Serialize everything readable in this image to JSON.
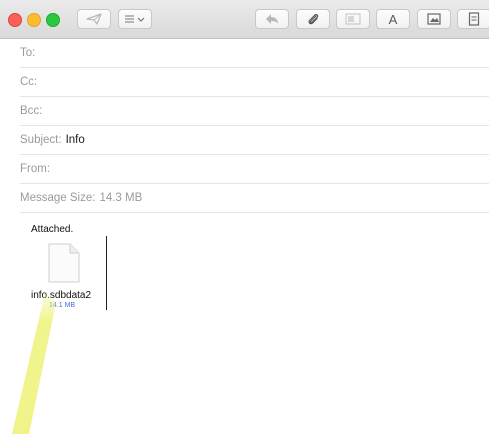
{
  "window": {
    "colors": {
      "close": "#fc5f57",
      "minimize": "#fdbc2e",
      "zoom": "#28c840"
    }
  },
  "toolbar": {
    "buttons": [
      {
        "name": "send-icon"
      },
      {
        "name": "list-format-icon"
      },
      {
        "name": "reply-icon"
      },
      {
        "name": "paperclip-icon"
      },
      {
        "name": "show-format-bar-icon"
      },
      {
        "name": "font-icon",
        "label": "A"
      },
      {
        "name": "photo-browser-icon"
      },
      {
        "name": "stationery-icon"
      }
    ]
  },
  "header": {
    "to_label": "To:",
    "cc_label": "Cc:",
    "bcc_label": "Bcc:",
    "subject_label": "Subject:",
    "subject_value": "Info",
    "from_label": "From:",
    "message_size_label": "Message Size:",
    "message_size_value": "14.3 MB"
  },
  "body": {
    "text": "Attached.",
    "attachment": {
      "filename": "info.sdbdata2",
      "size": "14.1 MB",
      "icon": "document-icon"
    }
  },
  "overlay": {
    "highlight_color": "#eef27a"
  }
}
